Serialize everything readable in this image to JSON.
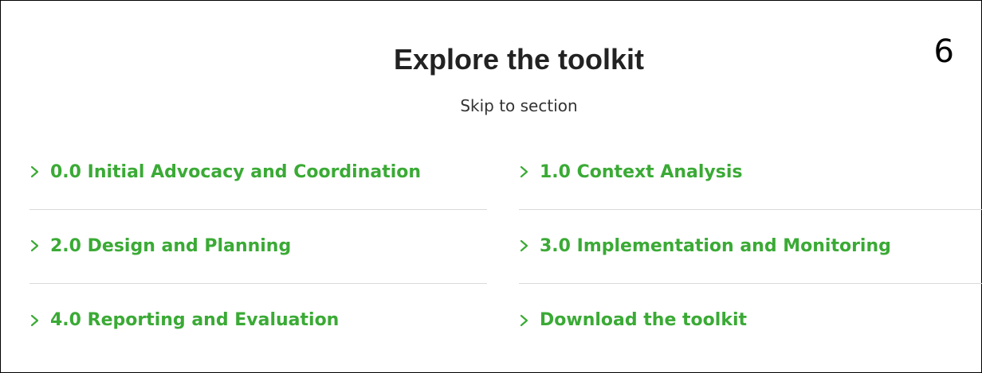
{
  "page_number": "6",
  "header": {
    "title": "Explore the toolkit",
    "subtitle": "Skip to section"
  },
  "links": [
    {
      "label": "0.0 Initial Advocacy and Coordination",
      "icon": "chevron-right-icon"
    },
    {
      "label": "1.0 Context Analysis",
      "icon": "chevron-right-icon"
    },
    {
      "label": "2.0 Design and Planning",
      "icon": "chevron-right-icon"
    },
    {
      "label": "3.0 Implementation and Monitoring",
      "icon": "chevron-right-icon"
    },
    {
      "label": "4.0 Reporting and Evaluation",
      "icon": "chevron-right-icon"
    },
    {
      "label": "Download the toolkit",
      "icon": "chevron-right-icon"
    }
  ],
  "colors": {
    "link": "#3aaa35",
    "title": "#222222",
    "divider": "#d9d9d9"
  }
}
